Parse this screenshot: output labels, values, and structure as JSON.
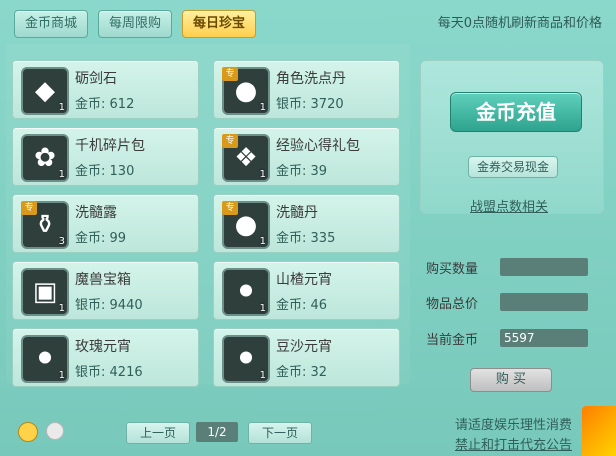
{
  "tabs": [
    {
      "label": "金币商城",
      "active": false
    },
    {
      "label": "每周限购",
      "active": false
    },
    {
      "label": "每日珍宝",
      "active": true
    }
  ],
  "notice": "每天0点随机刷新商品和价格",
  "items": [
    {
      "name": "砺剑石",
      "currency": "金币:",
      "price": "612",
      "qty": "1",
      "icon": "blue-crystal-icon",
      "tag": ""
    },
    {
      "name": "角色洗点丹",
      "currency": "银币:",
      "price": "3720",
      "qty": "1",
      "icon": "golden-pills-icon",
      "tag": "专"
    },
    {
      "name": "千机碎片包",
      "currency": "金币:",
      "price": "130",
      "qty": "1",
      "icon": "fragment-bundle-icon",
      "tag": ""
    },
    {
      "name": "经验心得礼包",
      "currency": "金币:",
      "price": "39",
      "qty": "1",
      "icon": "experience-gift-bag-icon",
      "tag": "专"
    },
    {
      "name": "洗髓露",
      "currency": "金币:",
      "price": "99",
      "qty": "3",
      "icon": "gourd-potion-icon",
      "tag": "专"
    },
    {
      "name": "洗髓丹",
      "currency": "金币:",
      "price": "335",
      "qty": "1",
      "icon": "green-pill-icon",
      "tag": "专"
    },
    {
      "name": "魔兽宝箱",
      "currency": "银币:",
      "price": "9440",
      "qty": "1",
      "icon": "treasure-chest-icon",
      "tag": ""
    },
    {
      "name": "山楂元宵",
      "currency": "金币:",
      "price": "46",
      "qty": "1",
      "icon": "hawthorn-dumplings-icon",
      "tag": ""
    },
    {
      "name": "玫瑰元宵",
      "currency": "银币:",
      "price": "4216",
      "qty": "1",
      "icon": "rose-dumplings-icon",
      "tag": ""
    },
    {
      "name": "豆沙元宵",
      "currency": "金币:",
      "price": "32",
      "qty": "1",
      "icon": "redbean-dumplings-icon",
      "tag": ""
    }
  ],
  "right_panel": {
    "recharge_label": "金币充值",
    "exchange_label": "金券交易现金",
    "alliance_label": "战盟点数相关"
  },
  "purchase": {
    "quantity_label": "购买数量",
    "quantity_value": "",
    "total_label": "物品总价",
    "total_value": "",
    "current_gold_label": "当前金币",
    "current_gold_value": "5597",
    "buy_label": "购 买"
  },
  "pager": {
    "prev_label": "上一页",
    "page_text": "1/2",
    "next_label": "下一页"
  },
  "footer": {
    "line1": "请适度娱乐理性消费",
    "line2": "禁止和打击代充公告"
  },
  "colors": {
    "accent_teal": "#2ea38e",
    "active_tab": "#ffcf4d"
  }
}
